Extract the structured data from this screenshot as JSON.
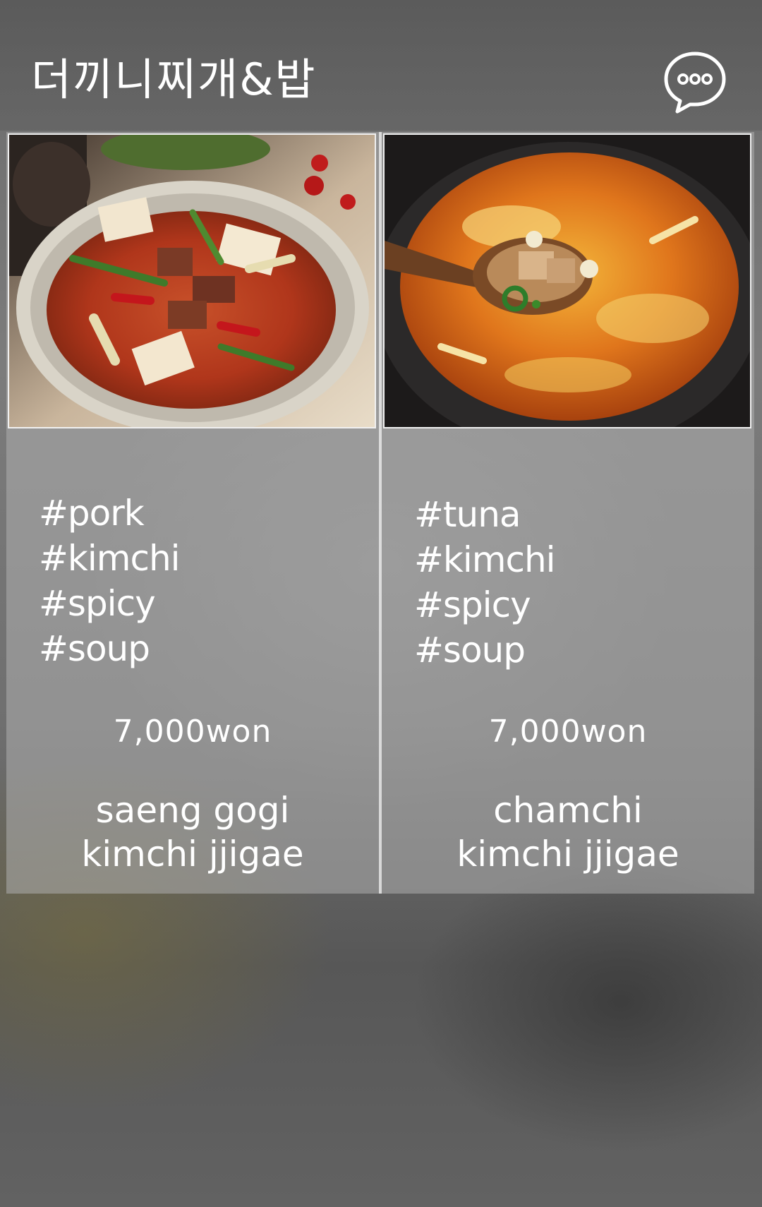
{
  "header": {
    "title": "더끼니찌개&밥",
    "chat_icon": "chat-bubble-ellipsis-icon"
  },
  "menu": [
    {
      "tags": [
        "#pork",
        "#kimchi",
        "#spicy",
        "#soup"
      ],
      "price": "7,000won",
      "name_line1": "saeng gogi",
      "name_line2": "kimchi jjigae"
    },
    {
      "tags": [
        "#tuna",
        "#kimchi",
        "#spicy",
        "#soup"
      ],
      "price": "7,000won",
      "name_line1": "chamchi",
      "name_line2": "kimchi jjigae"
    }
  ]
}
